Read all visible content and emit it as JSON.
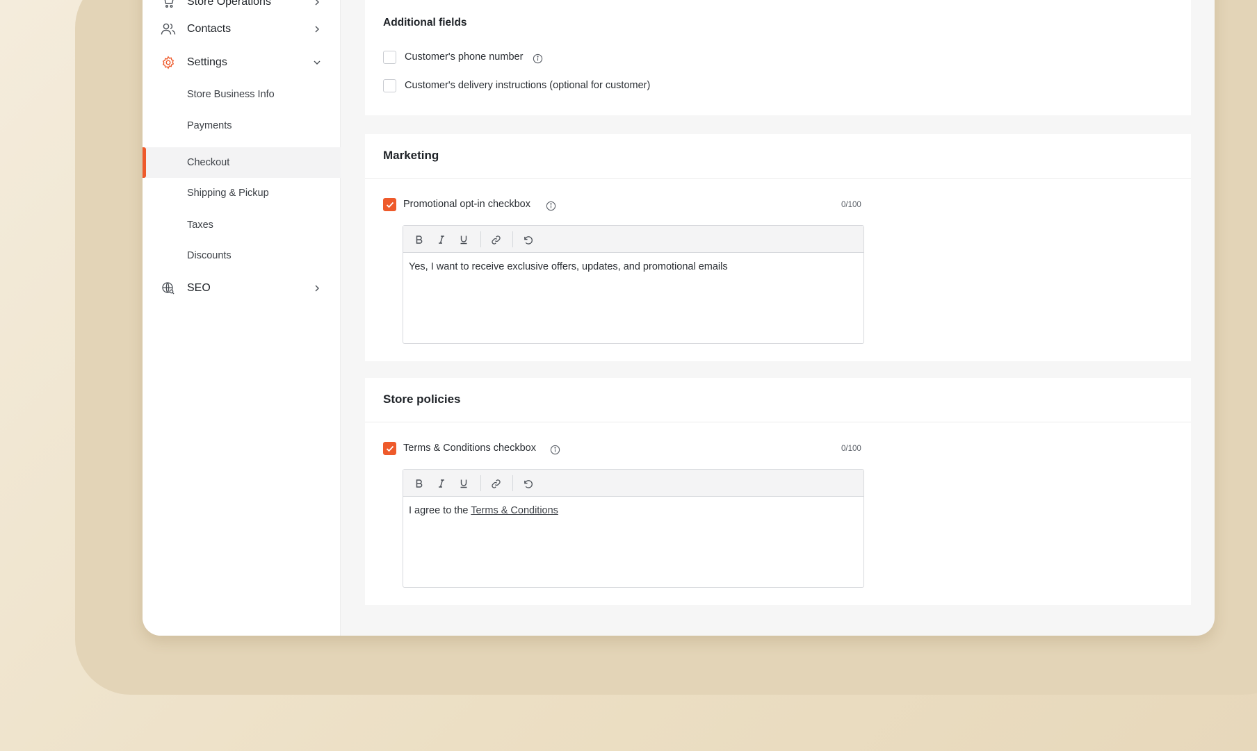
{
  "sidebar": {
    "store_operations": "Store Operations",
    "contacts": "Contacts",
    "settings": "Settings",
    "sub_items": {
      "store_business_info": "Store Business Info",
      "payments": "Payments",
      "checkout": "Checkout",
      "shipping_pickup": "Shipping & Pickup",
      "taxes": "Taxes",
      "discounts": "Discounts"
    },
    "seo": "SEO",
    "active_item": "Checkout",
    "accent_color": "#ee5a2b"
  },
  "additional_fields": {
    "title": "Additional fields",
    "phone_label": "Customer's phone number",
    "phone_checked": false,
    "delivery_label": "Customer's delivery instructions (optional for customer)",
    "delivery_checked": false
  },
  "marketing": {
    "title": "Marketing",
    "optin_label": "Promotional opt-in checkbox",
    "optin_checked": true,
    "counter": "0/100",
    "editor_text": "Yes, I want to receive exclusive offers, updates, and promotional emails"
  },
  "store_policies": {
    "title": "Store policies",
    "terms_label": "Terms & Conditions checkbox",
    "terms_checked": true,
    "counter": "0/100",
    "editor_prefix": "I agree to the ",
    "editor_link": "Terms & Conditions"
  },
  "toolbar_icons": [
    "bold-icon",
    "italic-icon",
    "underline-icon",
    "link-icon",
    "undo-icon"
  ]
}
